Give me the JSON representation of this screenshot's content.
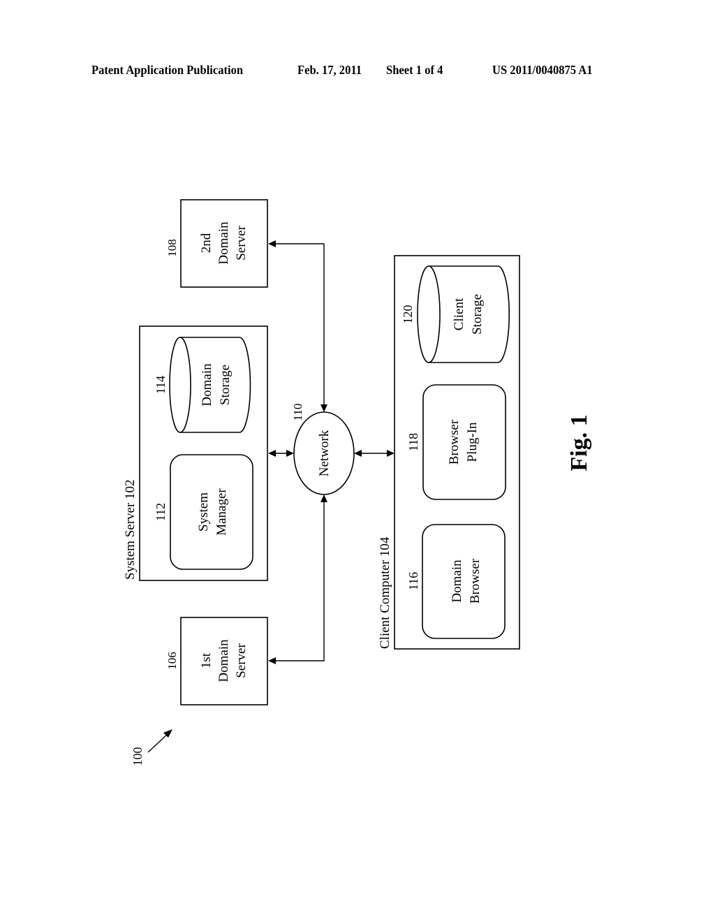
{
  "header": {
    "publication": "Patent Application Publication",
    "date": "Feb. 17, 2011",
    "sheet": "Sheet 1 of 4",
    "number": "US 2011/0040875 A1"
  },
  "figure": {
    "label": "Fig. 1",
    "system_ref": "100",
    "nodes": {
      "second_domain_server": {
        "ref": "108",
        "lines": [
          "2nd",
          "Domain",
          "Server"
        ]
      },
      "first_domain_server": {
        "ref": "106",
        "lines": [
          "1st",
          "Domain",
          "Server"
        ]
      },
      "system_server": {
        "title": "System Server 102"
      },
      "domain_storage": {
        "ref": "114",
        "lines": [
          "Domain",
          "Storage"
        ]
      },
      "system_manager": {
        "ref": "112",
        "lines": [
          "System",
          "Manager"
        ]
      },
      "network": {
        "ref": "110",
        "label": "Network"
      },
      "client_computer": {
        "title": "Client Computer 104"
      },
      "client_storage": {
        "ref": "120",
        "lines": [
          "Client",
          "Storage"
        ]
      },
      "browser_plugin": {
        "ref": "118",
        "lines": [
          "Browser",
          "Plug-In"
        ]
      },
      "domain_browser": {
        "ref": "116",
        "lines": [
          "Domain",
          "Browser"
        ]
      }
    }
  }
}
